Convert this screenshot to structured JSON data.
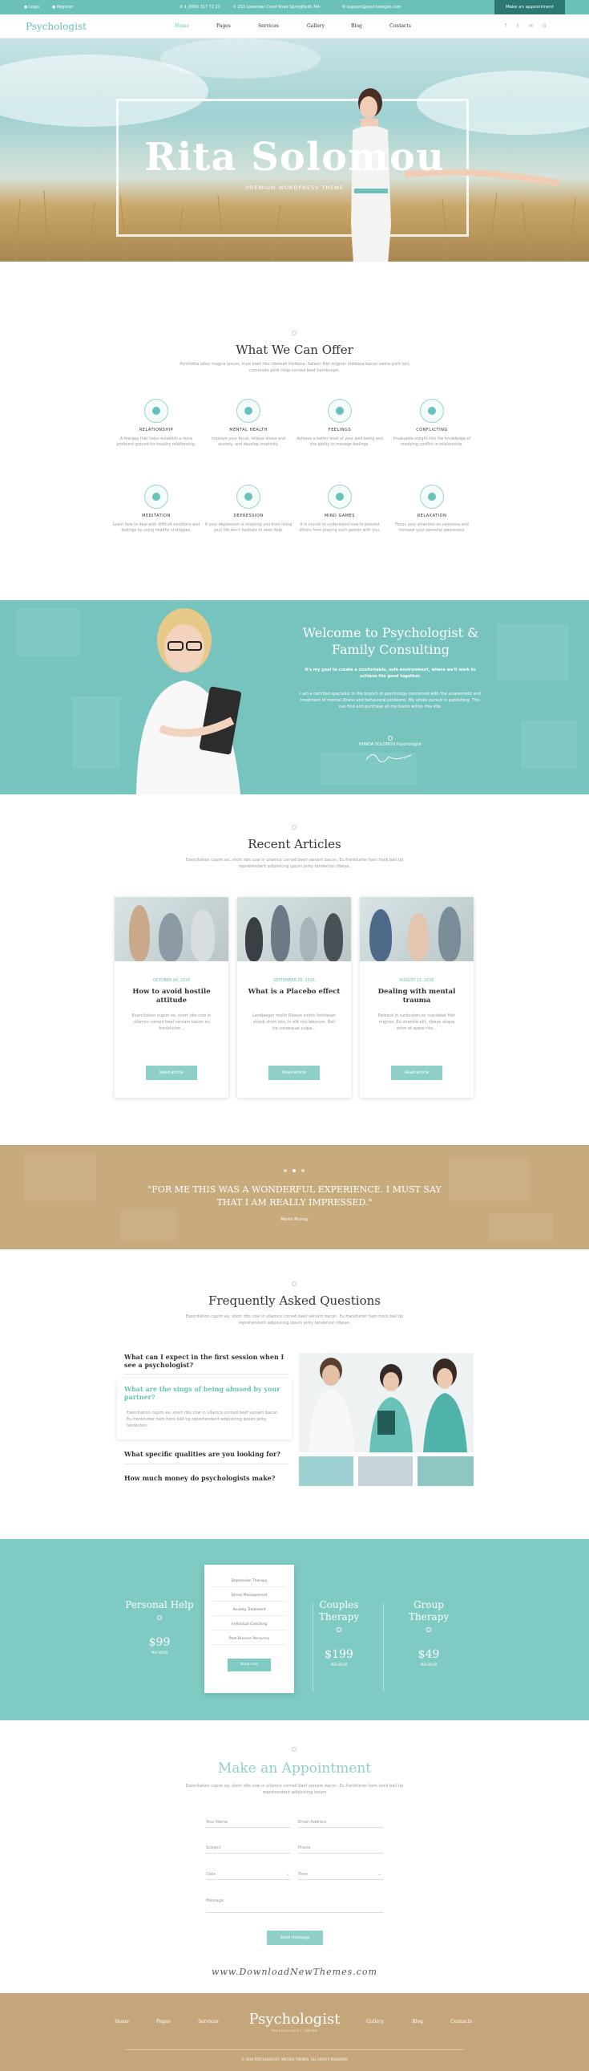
{
  "topbar": {
    "login": "Login",
    "register": "Register",
    "phone": "1 (800) 317 72 21",
    "address": "253 Lavender Crest Road Springfield, MA",
    "email": "support@psychologist.com",
    "appointment": "Make an appointment"
  },
  "nav": {
    "logo": "Psychologist",
    "items": [
      "Home",
      "Pages",
      "Services",
      "Gallery",
      "Blog",
      "Contacts"
    ],
    "social": [
      "f",
      "t",
      "✉",
      "G"
    ]
  },
  "hero": {
    "title": "Rita Solomou",
    "subtitle": "PREMIUM WORDPRESS THEME"
  },
  "offer": {
    "title": "What We Can Offer",
    "subtitle": "Porchetta labor magna ipsum, Irure beef ribs ribsteak kielbasa. Salami filet mignon kielbasa bacon swine pork loin commodo pork chop corned beef hamburger.",
    "items": [
      {
        "name": "RELATIONSHIP",
        "desc": "A therapy that helps establish a more profound ground for healthy relationship."
      },
      {
        "name": "MENTAL HEALTH",
        "desc": "Improve your focus, relieve stress and anxiety, and develop creativity."
      },
      {
        "name": "FEELINGS",
        "desc": "Achieve a better level of your well-being and the ability to manage feelings."
      },
      {
        "name": "CONFLICTING",
        "desc": "Invaluable insight into the knowledge of resolving conflict in relationship."
      },
      {
        "name": "MEDITATION",
        "desc": "Learn how to deal with difficult emotions and feelings by using healthy strategies."
      },
      {
        "name": "DEPRESSION",
        "desc": "If your depression is stopping you from living your life don't hesitate to seek help."
      },
      {
        "name": "MIND GAMES",
        "desc": "It is crucial to understand how to prevent others from playing such games with you."
      },
      {
        "name": "RELAXATION",
        "desc": "Focus your attention on calmness and increase your personal awareness."
      }
    ]
  },
  "welcome": {
    "title": "Welcome to Psychologist & Family Consulting",
    "bold": "It's my goal to create a comfortable, safe environment, where we'll work to achieve the good together.",
    "text": "I am a certified specialist in the branch of psychology concerned with the assessment and treatment of mental illness and behavioral problems. My whole pursuit is publishing. This can find and purchase all my books within this site.",
    "signature": "RHNDA SOLOMOU Psychologist"
  },
  "articles": {
    "title": "Recent Articles",
    "subtitle": "Exercitation cupim ex, short ribs cow in ullamco corned beef veniam bacon. Eu frankfurter ham hock ball tip reprehenderit adipisicing ipsum jerky tenderloin ribeye.",
    "cards": [
      {
        "date": "OCTOBER 04, 2016",
        "title": "How to avoid hostile attitude",
        "text": "Exercitation cupim ex, short ribs cow in ullamco corned beef veniam bacon eu frankfurter...",
        "btn": "Read article"
      },
      {
        "date": "SEPTEMBER 20, 2016",
        "title": "What is a Placebo effect",
        "text": "Landjaeger mollit Ribeye sirloin fortdeken shank short loin. In elit nisi laborum. Ball tip consequat culpa...",
        "btn": "Read article"
      },
      {
        "date": "AUGUST 11, 2016",
        "title": "Dealing with mental trauma",
        "text": "Fatback in turducken ex cupidatat filet mignon. Eu shankle elit, ribeye aliqua enim et spare ribs...",
        "btn": "Read article"
      }
    ]
  },
  "testimonial": {
    "quote": "\"FOR ME THIS WAS A WONDERFUL EXPERIENCE. I MUST SAY THAT I AM REALLY IMPRESSED.\"",
    "author": "Merlin Murray"
  },
  "faq": {
    "title": "Frequently Asked Questions",
    "subtitle": "Exercitation cupim ex, short ribs cow in ullamco corned beef veniam bacon. Eu frankfurter ham hock ball tip reprehenderit adipisicing ipsum jerky tenderloin ribeye.",
    "items": [
      {
        "q": "What can I expect in the first session when I see a psychologist?"
      },
      {
        "q": "What are the sings of being abused by your partner?",
        "a": "Exercitation cupim ex, short ribs cow in ullamco corned beef veniam bacon. Eu frankfurter ham hock ball tip reprehenderit adipisicing ipsum jerky tenderloin."
      },
      {
        "q": "What specific qualities are you looking for?"
      },
      {
        "q": "How much money do psychologists make?"
      }
    ]
  },
  "pricing": {
    "plans": [
      {
        "name": "Personal Help",
        "price": "$99",
        "period": "PER HOUR"
      },
      {
        "name": "Couples Therapy",
        "price": "$199",
        "period": "PER HOUR"
      },
      {
        "name": "Group Therapy",
        "price": "$49",
        "period": "PER HOUR"
      }
    ],
    "features": [
      "Depression Therapy",
      "Stress Management",
      "Anxiety Treatment",
      "Individual Coaching",
      "Post-Divorce Recovery"
    ],
    "book": "Book now"
  },
  "appointment": {
    "title": "Make an Appointment",
    "subtitle": "Exercitation cupim ex, short ribs cow in ullamco corned beef veniam bacon. Eu frankfurter ham hock ball tip reprehenderit adipisicing ipsum",
    "fields": {
      "name": "Your Name",
      "email": "Email Address",
      "subject": "Subject",
      "phone": "Phone",
      "date": "Date",
      "time": "Time",
      "message": "Message"
    },
    "send": "Send message",
    "watermark": "www.DownloadNewThemes.com"
  },
  "footer": {
    "left": [
      "Home",
      "Pages",
      "Services"
    ],
    "right": [
      "Gallery",
      "Blog",
      "Contacts"
    ],
    "logo": "Psychologist",
    "tagline": "PSYCHOLOGIST THEME",
    "copyright": "© 2016 PSYCHOLOGIST. ANCORA THEMES. ALL RIGHTS RESERVED"
  },
  "colors": {
    "accent": "#6ac1b7",
    "gold": "#c4a67a",
    "dark": "#333333"
  }
}
